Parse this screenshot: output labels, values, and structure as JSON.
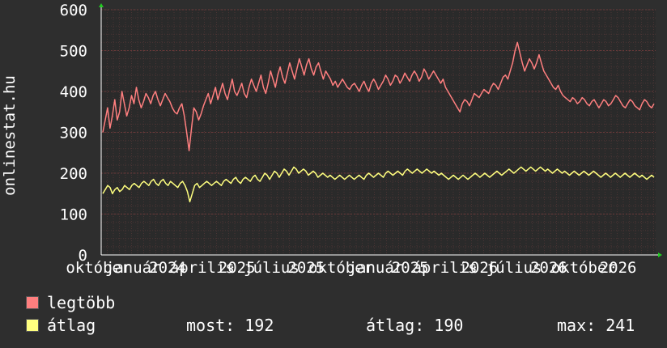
{
  "chart_data": {
    "type": "line",
    "ylabel": "onlinestat.hu",
    "ylim": [
      0,
      600
    ],
    "yticks": [
      "0",
      "100",
      "200",
      "300",
      "400",
      "500",
      "600"
    ],
    "xticks": [
      "október",
      "január",
      "2024",
      "április",
      "2025",
      "július",
      "2025",
      "október",
      "január",
      "2025",
      "április",
      "2026",
      "július",
      "2026",
      "október",
      "2026"
    ],
    "grid": true,
    "colors": {
      "background": "#2e2e2e",
      "plot": "#2a2a2a",
      "grid": "#6a3a3a",
      "axis": "#ffffff",
      "legtobb": "#ff7f7f",
      "atlag": "#ffff7f"
    },
    "series": [
      {
        "name": "legtöbb",
        "values": [
          300,
          330,
          360,
          310,
          340,
          380,
          330,
          350,
          400,
          370,
          340,
          360,
          390,
          370,
          410,
          380,
          360,
          375,
          395,
          385,
          370,
          390,
          400,
          380,
          365,
          380,
          395,
          385,
          375,
          360,
          350,
          345,
          360,
          370,
          340,
          300,
          255,
          310,
          360,
          350,
          330,
          345,
          365,
          380,
          395,
          370,
          390,
          410,
          380,
          400,
          420,
          395,
          380,
          405,
          430,
          400,
          390,
          405,
          420,
          395,
          385,
          410,
          430,
          415,
          400,
          420,
          440,
          410,
          395,
          420,
          450,
          430,
          410,
          440,
          460,
          435,
          420,
          445,
          470,
          450,
          430,
          455,
          480,
          460,
          440,
          465,
          480,
          455,
          440,
          460,
          470,
          450,
          430,
          450,
          440,
          430,
          415,
          425,
          410,
          420,
          430,
          420,
          410,
          405,
          415,
          420,
          410,
          400,
          415,
          425,
          410,
          400,
          420,
          430,
          420,
          405,
          415,
          425,
          440,
          430,
          415,
          425,
          440,
          435,
          420,
          430,
          445,
          435,
          425,
          440,
          450,
          440,
          425,
          435,
          455,
          445,
          430,
          440,
          450,
          440,
          430,
          420,
          430,
          410,
          400,
          390,
          380,
          370,
          360,
          350,
          370,
          380,
          375,
          365,
          380,
          395,
          390,
          385,
          395,
          405,
          400,
          395,
          410,
          420,
          415,
          405,
          420,
          435,
          440,
          430,
          450,
          470,
          500,
          520,
          495,
          470,
          450,
          465,
          480,
          470,
          455,
          470,
          490,
          470,
          450,
          440,
          430,
          420,
          410,
          405,
          415,
          400,
          390,
          385,
          380,
          375,
          385,
          380,
          370,
          375,
          385,
          380,
          370,
          365,
          375,
          380,
          370,
          360,
          370,
          380,
          375,
          365,
          370,
          380,
          390,
          385,
          375,
          365,
          360,
          370,
          380,
          375,
          365,
          360,
          355,
          370,
          380,
          375,
          365,
          360,
          370
        ]
      },
      {
        "name": "átlag",
        "values": [
          150,
          160,
          170,
          165,
          150,
          160,
          165,
          155,
          160,
          170,
          165,
          160,
          170,
          175,
          170,
          165,
          175,
          180,
          175,
          170,
          180,
          185,
          175,
          170,
          180,
          185,
          175,
          170,
          180,
          175,
          170,
          165,
          175,
          180,
          170,
          155,
          130,
          150,
          170,
          175,
          165,
          170,
          175,
          180,
          175,
          170,
          175,
          180,
          175,
          170,
          180,
          185,
          180,
          175,
          185,
          190,
          180,
          175,
          185,
          190,
          185,
          180,
          190,
          195,
          185,
          180,
          190,
          200,
          195,
          185,
          195,
          205,
          200,
          190,
          200,
          210,
          205,
          195,
          205,
          215,
          210,
          200,
          205,
          210,
          205,
          195,
          200,
          205,
          200,
          190,
          195,
          200,
          195,
          190,
          195,
          190,
          185,
          190,
          195,
          190,
          185,
          190,
          195,
          190,
          185,
          190,
          195,
          190,
          185,
          195,
          200,
          195,
          190,
          195,
          200,
          195,
          190,
          200,
          205,
          200,
          195,
          200,
          205,
          200,
          195,
          205,
          210,
          205,
          200,
          205,
          210,
          205,
          200,
          205,
          210,
          205,
          200,
          205,
          200,
          195,
          200,
          195,
          190,
          185,
          190,
          195,
          190,
          185,
          190,
          195,
          190,
          185,
          190,
          195,
          200,
          195,
          190,
          195,
          200,
          195,
          190,
          195,
          200,
          205,
          200,
          195,
          200,
          205,
          210,
          205,
          200,
          205,
          210,
          215,
          210,
          205,
          210,
          215,
          210,
          205,
          210,
          215,
          210,
          205,
          210,
          205,
          200,
          205,
          210,
          205,
          200,
          205,
          200,
          195,
          200,
          205,
          200,
          195,
          200,
          205,
          200,
          195,
          200,
          205,
          200,
          195,
          190,
          195,
          200,
          195,
          190,
          195,
          200,
          195,
          190,
          195,
          200,
          195,
          190,
          195,
          200,
          195,
          190,
          195,
          190,
          185,
          190,
          195,
          190
        ]
      }
    ]
  },
  "legend": {
    "items": [
      {
        "label": "legtöbb",
        "color": "#ff7f7f"
      },
      {
        "label": "átlag",
        "color": "#ffff7f"
      }
    ],
    "stats": {
      "most": "most: 192",
      "atlag": "átlag: 190",
      "max": "max: 241"
    }
  }
}
